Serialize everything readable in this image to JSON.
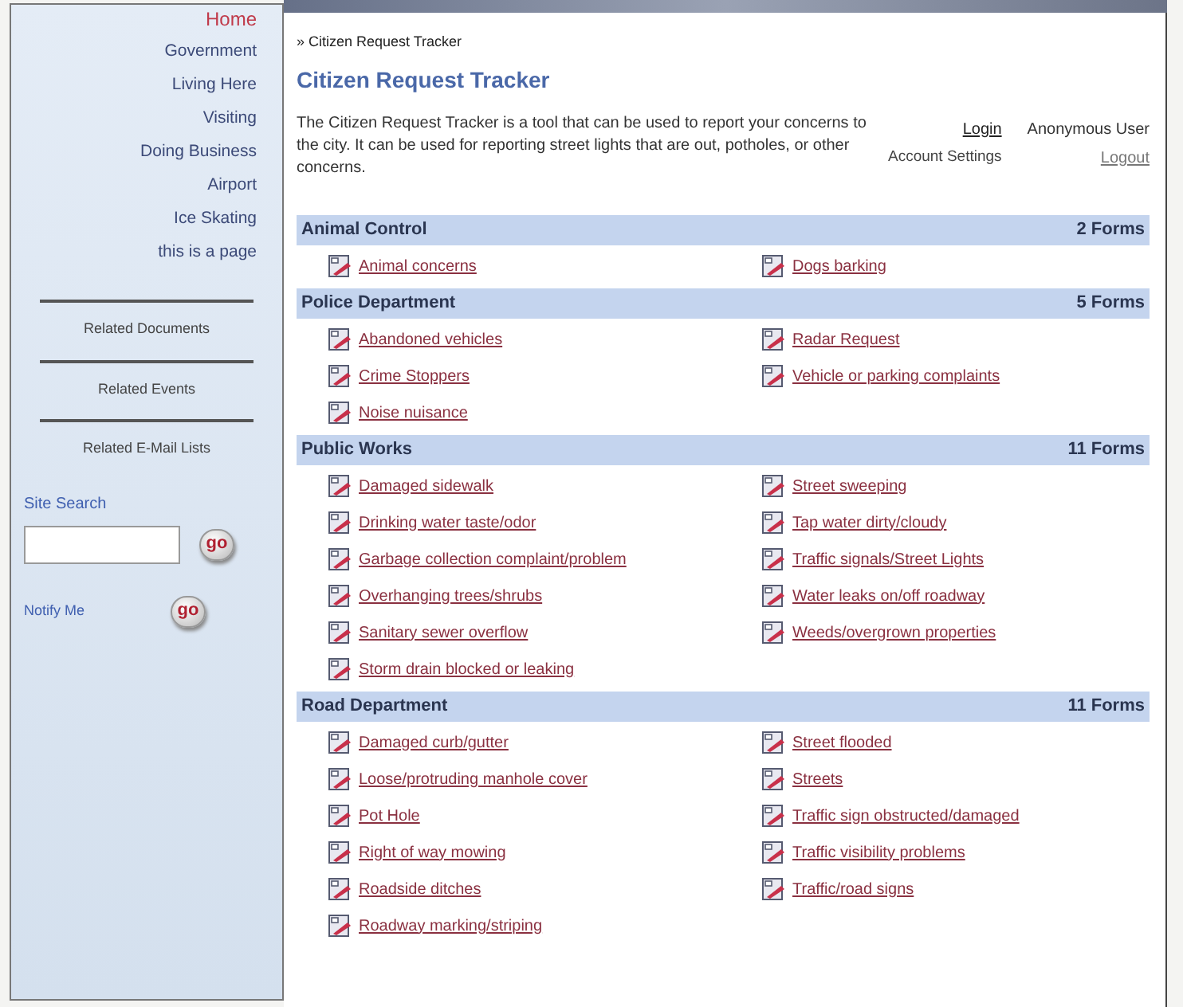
{
  "sidebar": {
    "nav": [
      {
        "label": "Home",
        "selected": true
      },
      {
        "label": "Government",
        "selected": false
      },
      {
        "label": "Living Here",
        "selected": false
      },
      {
        "label": "Visiting",
        "selected": false
      },
      {
        "label": "Doing Business",
        "selected": false
      },
      {
        "label": "Airport",
        "selected": false
      },
      {
        "label": "Ice Skating",
        "selected": false
      },
      {
        "label": "this is a page",
        "selected": false
      }
    ],
    "related": [
      "Related Documents",
      "Related Events",
      "Related E-Mail Lists"
    ],
    "search": {
      "label": "Site Search",
      "button": "go"
    },
    "notify": {
      "label": "Notify Me",
      "button": "go"
    }
  },
  "breadcrumb": "» Citizen Request Tracker",
  "title": "Citizen Request Tracker",
  "description": "The Citizen Request Tracker is a tool that can be used to report your concerns to the city. It can be used for reporting street lights that are out, potholes, or other concerns.",
  "account": {
    "login": "Login",
    "user": "Anonymous User",
    "settings": "Account Settings",
    "logout": "Logout"
  },
  "sections": [
    {
      "name": "Animal Control",
      "count": "2 Forms",
      "forms": [
        "Animal concerns",
        "Dogs barking"
      ]
    },
    {
      "name": "Police Department",
      "count": "5 Forms",
      "forms": [
        "Abandoned vehicles",
        "Radar Request",
        "Crime Stoppers",
        "Vehicle or parking complaints",
        "Noise nuisance"
      ]
    },
    {
      "name": "Public Works",
      "count": "11 Forms",
      "forms": [
        "Damaged sidewalk",
        "Street sweeping",
        "Drinking water taste/odor",
        "Tap water dirty/cloudy",
        "Garbage collection complaint/problem",
        "Traffic signals/Street Lights",
        "Overhanging trees/shrubs",
        "Water leaks on/off roadway",
        "Sanitary sewer overflow",
        "Weeds/overgrown properties",
        "Storm drain blocked or leaking"
      ]
    },
    {
      "name": "Road Department",
      "count": "11 Forms",
      "forms": [
        "Damaged curb/gutter",
        "Street flooded",
        "Loose/protruding manhole cover",
        "Streets",
        "Pot Hole",
        "Traffic sign obstructed/damaged",
        "Right of way mowing",
        "Traffic visibility problems",
        "Roadside ditches",
        "Traffic/road signs",
        "Roadway marking/striping"
      ]
    }
  ]
}
